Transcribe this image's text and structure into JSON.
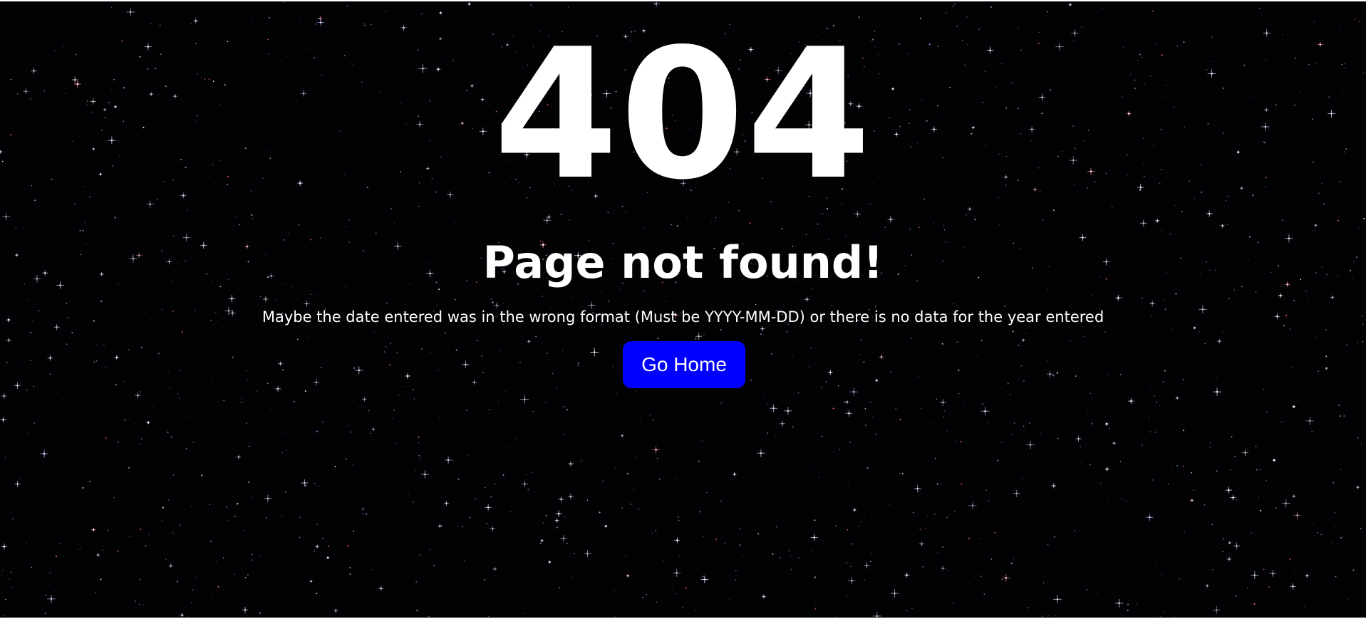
{
  "background": {
    "color": "#020104",
    "star_colors": [
      "#ffffff",
      "#9fa8ff",
      "#ff6fa0",
      "#c9b6ff"
    ]
  },
  "error": {
    "code": "404",
    "title": "Page not found!",
    "message": "Maybe the date entered was in the wrong format (Must be YYYY-MM-DD) or there is no data for the year entered"
  },
  "actions": {
    "home_label": "Go Home",
    "home_color": "#0000ff"
  }
}
